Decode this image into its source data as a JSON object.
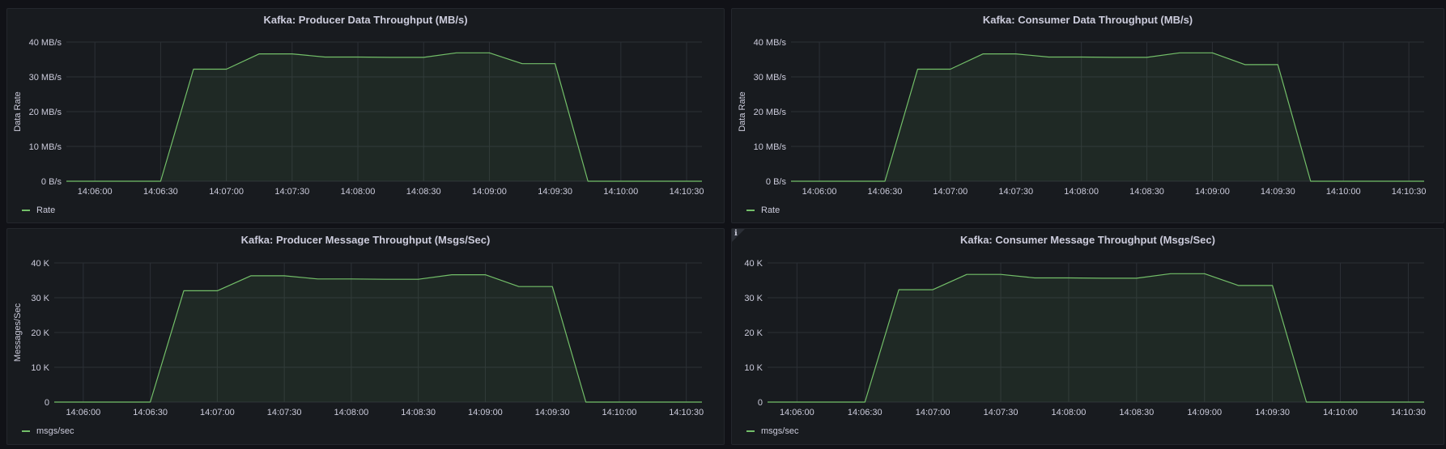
{
  "accent_color": "#73bf69",
  "panels": [
    {
      "title": "Kafka: Producer Data Throughput (MB/s)",
      "legend": "Rate",
      "info": false
    },
    {
      "title": "Kafka: Consumer Data Throughput (MB/s)",
      "legend": "Rate",
      "info": false
    },
    {
      "title": "Kafka: Producer Message Throughput (Msgs/Sec)",
      "legend": "msgs/sec",
      "info": false
    },
    {
      "title": "Kafka: Consumer Message Throughput (Msgs/Sec)",
      "legend": "msgs/sec",
      "info": true,
      "info_glyph": "ℹ"
    }
  ],
  "chart_data": [
    {
      "type": "area",
      "title": "Kafka: Producer Data Throughput (MB/s)",
      "ylabel": "Data Rate",
      "ylim": [
        0,
        40
      ],
      "y_ticks": [
        0,
        10,
        20,
        30,
        40
      ],
      "y_tick_labels": [
        "0 B/s",
        "10 MB/s",
        "20 MB/s",
        "30 MB/s",
        "40 MB/s"
      ],
      "x_ticks": [
        "14:06:00",
        "14:06:30",
        "14:07:00",
        "14:07:30",
        "14:08:00",
        "14:08:30",
        "14:09:00",
        "14:09:30",
        "14:10:00",
        "14:10:30"
      ],
      "grid": true,
      "legend_position": "bottom-left",
      "series": [
        {
          "name": "Rate",
          "color": "#73bf69",
          "x": [
            "14:05:47",
            "14:06:30",
            "14:06:45",
            "14:07:00",
            "14:07:15",
            "14:07:30",
            "14:07:45",
            "14:08:00",
            "14:08:15",
            "14:08:30",
            "14:08:45",
            "14:09:00",
            "14:09:15",
            "14:09:30",
            "14:09:45",
            "14:10:00",
            "14:10:15",
            "14:10:30",
            "14:10:37"
          ],
          "values": [
            0,
            0,
            32.2,
            32.2,
            36.6,
            36.6,
            35.7,
            35.7,
            35.6,
            35.6,
            36.9,
            36.9,
            33.8,
            33.8,
            0,
            0,
            0,
            0,
            0
          ]
        }
      ]
    },
    {
      "type": "area",
      "title": "Kafka: Consumer Data Throughput (MB/s)",
      "ylabel": "Data Rate",
      "ylim": [
        0,
        40
      ],
      "y_ticks": [
        0,
        10,
        20,
        30,
        40
      ],
      "y_tick_labels": [
        "0 B/s",
        "10 MB/s",
        "20 MB/s",
        "30 MB/s",
        "40 MB/s"
      ],
      "x_ticks": [
        "14:06:00",
        "14:06:30",
        "14:07:00",
        "14:07:30",
        "14:08:00",
        "14:08:30",
        "14:09:00",
        "14:09:30",
        "14:10:00",
        "14:10:30"
      ],
      "grid": true,
      "legend_position": "bottom-left",
      "series": [
        {
          "name": "Rate",
          "color": "#73bf69",
          "x": [
            "14:05:47",
            "14:06:30",
            "14:06:45",
            "14:07:00",
            "14:07:15",
            "14:07:30",
            "14:07:45",
            "14:08:00",
            "14:08:15",
            "14:08:30",
            "14:08:45",
            "14:09:00",
            "14:09:15",
            "14:09:30",
            "14:09:45",
            "14:10:00",
            "14:10:15",
            "14:10:30",
            "14:10:37"
          ],
          "values": [
            0,
            0,
            32.2,
            32.2,
            36.6,
            36.6,
            35.7,
            35.7,
            35.6,
            35.6,
            36.9,
            36.9,
            33.5,
            33.5,
            0,
            0,
            0,
            0,
            0
          ]
        }
      ]
    },
    {
      "type": "area",
      "title": "Kafka: Producer Message Throughput (Msgs/Sec)",
      "ylabel": "Messages/Sec",
      "ylim": [
        0,
        40000
      ],
      "y_ticks": [
        0,
        10000,
        20000,
        30000,
        40000
      ],
      "y_tick_labels": [
        "0",
        "10 K",
        "20 K",
        "30 K",
        "40 K"
      ],
      "x_ticks": [
        "14:06:00",
        "14:06:30",
        "14:07:00",
        "14:07:30",
        "14:08:00",
        "14:08:30",
        "14:09:00",
        "14:09:30",
        "14:10:00",
        "14:10:30"
      ],
      "grid": true,
      "legend_position": "bottom-left",
      "series": [
        {
          "name": "msgs/sec",
          "color": "#73bf69",
          "x": [
            "14:05:47",
            "14:06:30",
            "14:06:45",
            "14:07:00",
            "14:07:15",
            "14:07:30",
            "14:07:45",
            "14:08:00",
            "14:08:15",
            "14:08:30",
            "14:08:45",
            "14:09:00",
            "14:09:15",
            "14:09:30",
            "14:09:45",
            "14:10:00",
            "14:10:15",
            "14:10:30",
            "14:10:37"
          ],
          "values": [
            0,
            0,
            32000,
            32000,
            36300,
            36300,
            35400,
            35400,
            35300,
            35300,
            36600,
            36600,
            33200,
            33200,
            0,
            0,
            0,
            0,
            0
          ]
        }
      ]
    },
    {
      "type": "area",
      "title": "Kafka: Consumer Message Throughput (Msgs/Sec)",
      "ylabel": "",
      "ylim": [
        0,
        40000
      ],
      "y_ticks": [
        0,
        10000,
        20000,
        30000,
        40000
      ],
      "y_tick_labels": [
        "0",
        "10 K",
        "20 K",
        "30 K",
        "40 K"
      ],
      "x_ticks": [
        "14:06:00",
        "14:06:30",
        "14:07:00",
        "14:07:30",
        "14:08:00",
        "14:08:30",
        "14:09:00",
        "14:09:30",
        "14:10:00",
        "14:10:30"
      ],
      "grid": true,
      "legend_position": "bottom-left",
      "series": [
        {
          "name": "msgs/sec",
          "color": "#73bf69",
          "x": [
            "14:05:47",
            "14:06:30",
            "14:06:45",
            "14:07:00",
            "14:07:15",
            "14:07:30",
            "14:07:45",
            "14:08:00",
            "14:08:15",
            "14:08:30",
            "14:08:45",
            "14:09:00",
            "14:09:15",
            "14:09:30",
            "14:09:45",
            "14:10:00",
            "14:10:15",
            "14:10:30",
            "14:10:37"
          ],
          "values": [
            0,
            0,
            32300,
            32300,
            36700,
            36700,
            35700,
            35700,
            35600,
            35600,
            36900,
            36900,
            33500,
            33500,
            0,
            0,
            0,
            0,
            0
          ]
        }
      ]
    }
  ]
}
